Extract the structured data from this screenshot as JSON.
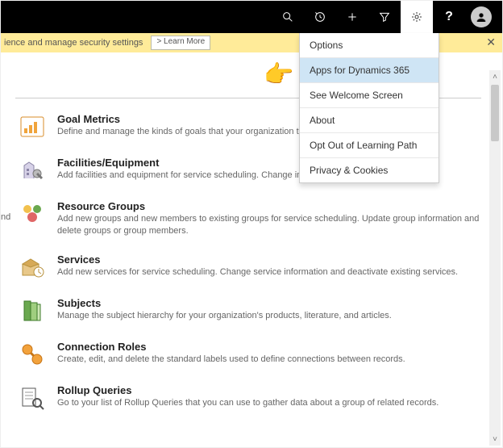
{
  "notice": {
    "text": "ience and manage security settings",
    "learn_more": "> Learn More"
  },
  "menu": {
    "items": [
      "Options",
      "Apps for Dynamics 365",
      "See Welcome Screen",
      "About",
      "Opt Out of Learning Path",
      "Privacy & Cookies"
    ],
    "highlight_index": 1
  },
  "partial_row": "nd",
  "sections": [
    {
      "title": "Goal Metrics",
      "desc": "Define and manage the kinds of goals that your organization tracks."
    },
    {
      "title": "Facilities/Equipment",
      "desc": "Add facilities and equipment for service scheduling. Change information about"
    },
    {
      "title": "Resource Groups",
      "desc": "Add new groups and new members to existing groups for service scheduling. Update group information and delete groups or group members."
    },
    {
      "title": "Services",
      "desc": "Add new services for service scheduling. Change service information and deactivate existing services."
    },
    {
      "title": "Subjects",
      "desc": "Manage the subject hierarchy for your organization's products, literature, and articles."
    },
    {
      "title": "Connection Roles",
      "desc": "Create, edit, and delete the standard labels used to define connections between records."
    },
    {
      "title": "Rollup Queries",
      "desc": "Go to your list of Rollup Queries that you can use to gather data about a group of related records."
    }
  ]
}
